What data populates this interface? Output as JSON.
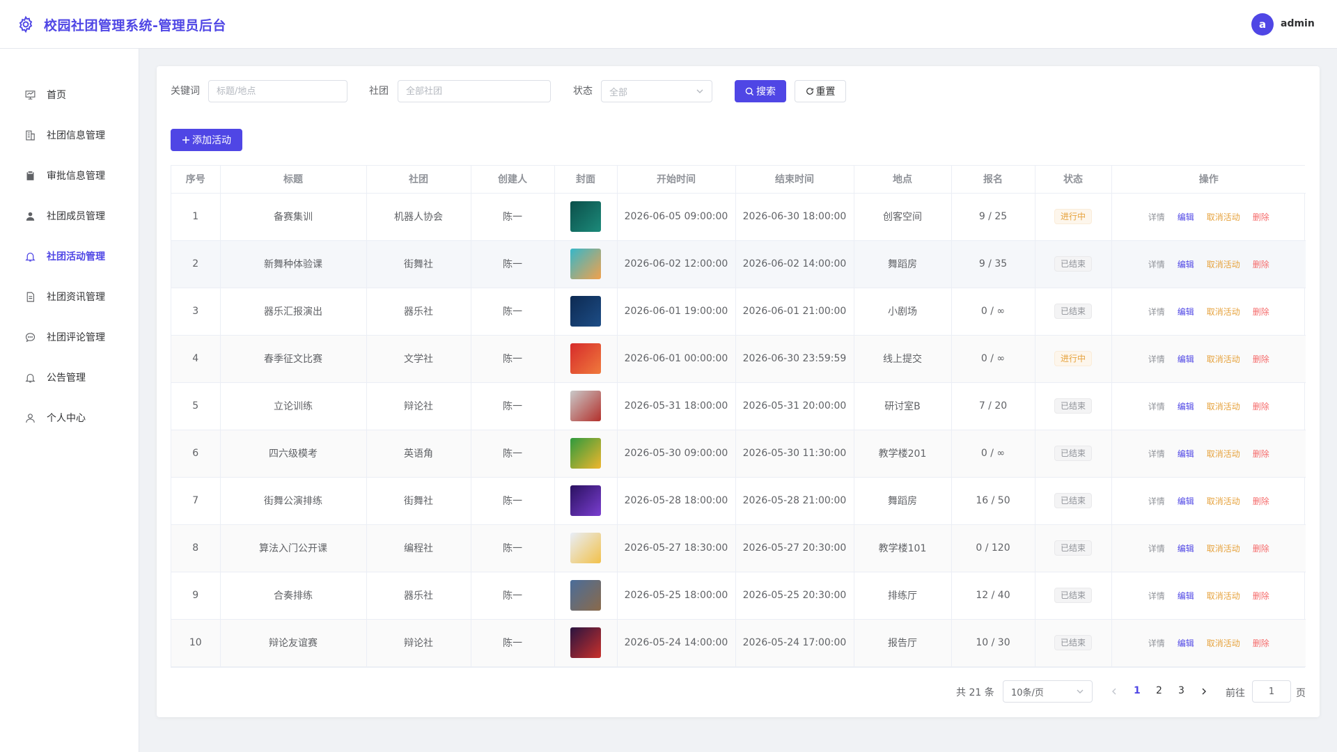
{
  "header": {
    "app_title": "校园社团管理系统-管理员后台",
    "avatar_letter": "a",
    "username": "admin"
  },
  "sidebar": {
    "items": [
      {
        "label": "首页",
        "icon": "home-icon"
      },
      {
        "label": "社团信息管理",
        "icon": "building-icon"
      },
      {
        "label": "审批信息管理",
        "icon": "clipboard-icon"
      },
      {
        "label": "社团成员管理",
        "icon": "user-icon"
      },
      {
        "label": "社团活动管理",
        "icon": "bell-icon",
        "active": true
      },
      {
        "label": "社团资讯管理",
        "icon": "document-icon"
      },
      {
        "label": "社团评论管理",
        "icon": "chat-icon"
      },
      {
        "label": "公告管理",
        "icon": "bell-icon"
      },
      {
        "label": "个人中心",
        "icon": "user-outline-icon"
      }
    ]
  },
  "filters": {
    "keyword_label": "关键词",
    "keyword_placeholder": "标题/地点",
    "club_label": "社团",
    "club_placeholder": "全部社团",
    "status_label": "状态",
    "status_value": "全部",
    "search_label": "搜索",
    "reset_label": "重置",
    "add_label": "添加活动"
  },
  "table": {
    "headers": [
      "序号",
      "标题",
      "社团",
      "创建人",
      "封面",
      "开始时间",
      "结束时间",
      "地点",
      "报名",
      "状态",
      "操作"
    ],
    "ops": {
      "detail": "详情",
      "edit": "编辑",
      "cancel": "取消活动",
      "delete": "删除"
    },
    "rows": [
      {
        "no": "1",
        "title": "备赛集训",
        "club": "机器人协会",
        "creator": "陈一",
        "cover": [
          "#0b4f4a",
          "#1c8a7a"
        ],
        "start": "2026-06-05 09:00:00",
        "end": "2026-06-30 18:00:00",
        "place": "创客空间",
        "signup": "9 / 25",
        "status": "进行中",
        "status_type": "ongoing"
      },
      {
        "no": "2",
        "title": "新舞种体验课",
        "club": "街舞社",
        "creator": "陈一",
        "cover": [
          "#36b7c9",
          "#f2a14b"
        ],
        "start": "2026-06-02 12:00:00",
        "end": "2026-06-02 14:00:00",
        "place": "舞蹈房",
        "signup": "9 / 35",
        "status": "已结束",
        "status_type": "ended"
      },
      {
        "no": "3",
        "title": "器乐汇报演出",
        "club": "器乐社",
        "creator": "陈一",
        "cover": [
          "#0d2a52",
          "#1d4d86"
        ],
        "start": "2026-06-01 19:00:00",
        "end": "2026-06-01 21:00:00",
        "place": "小剧场",
        "signup": "0 / ∞",
        "status": "已结束",
        "status_type": "ended"
      },
      {
        "no": "4",
        "title": "春季征文比赛",
        "club": "文学社",
        "creator": "陈一",
        "cover": [
          "#d62b2b",
          "#f07a3c"
        ],
        "start": "2026-06-01 00:00:00",
        "end": "2026-06-30 23:59:59",
        "place": "线上提交",
        "signup": "0 / ∞",
        "status": "进行中",
        "status_type": "ongoing"
      },
      {
        "no": "5",
        "title": "立论训练",
        "club": "辩论社",
        "creator": "陈一",
        "cover": [
          "#c9c9c9",
          "#b3302b"
        ],
        "start": "2026-05-31 18:00:00",
        "end": "2026-05-31 20:00:00",
        "place": "研讨室B",
        "signup": "7 / 20",
        "status": "已结束",
        "status_type": "ended"
      },
      {
        "no": "6",
        "title": "四六级模考",
        "club": "英语角",
        "creator": "陈一",
        "cover": [
          "#2e9a3e",
          "#f0b62c"
        ],
        "start": "2026-05-30 09:00:00",
        "end": "2026-05-30 11:30:00",
        "place": "教学楼201",
        "signup": "0 / ∞",
        "status": "已结束",
        "status_type": "ended"
      },
      {
        "no": "7",
        "title": "街舞公演排练",
        "club": "街舞社",
        "creator": "陈一",
        "cover": [
          "#2a1160",
          "#7a3ed0"
        ],
        "start": "2026-05-28 18:00:00",
        "end": "2026-05-28 21:00:00",
        "place": "舞蹈房",
        "signup": "16 / 50",
        "status": "已结束",
        "status_type": "ended"
      },
      {
        "no": "8",
        "title": "算法入门公开课",
        "club": "编程社",
        "creator": "陈一",
        "cover": [
          "#e8eef8",
          "#f2c14a"
        ],
        "start": "2026-05-27 18:30:00",
        "end": "2026-05-27 20:30:00",
        "place": "教学楼101",
        "signup": "0 / 120",
        "status": "已结束",
        "status_type": "ended"
      },
      {
        "no": "9",
        "title": "合奏排练",
        "club": "器乐社",
        "creator": "陈一",
        "cover": [
          "#4a6d9a",
          "#8a6a4a"
        ],
        "start": "2026-05-25 18:00:00",
        "end": "2026-05-25 20:30:00",
        "place": "排练厅",
        "signup": "12 / 40",
        "status": "已结束",
        "status_type": "ended"
      },
      {
        "no": "10",
        "title": "辩论友谊赛",
        "club": "辩论社",
        "creator": "陈一",
        "cover": [
          "#2a1440",
          "#c9302b"
        ],
        "start": "2026-05-24 14:00:00",
        "end": "2026-05-24 17:00:00",
        "place": "报告厅",
        "signup": "10 / 30",
        "status": "已结束",
        "status_type": "ended"
      }
    ]
  },
  "pagination": {
    "total_text": "共 21 条",
    "page_size": "10条/页",
    "pages": [
      "1",
      "2",
      "3"
    ],
    "current_page": "1",
    "jump_prefix": "前往",
    "jump_value": "1",
    "jump_suffix": "页"
  },
  "colors": {
    "accent": "#4f46e5",
    "warning": "#e6a23c",
    "danger": "#f56c6c"
  }
}
